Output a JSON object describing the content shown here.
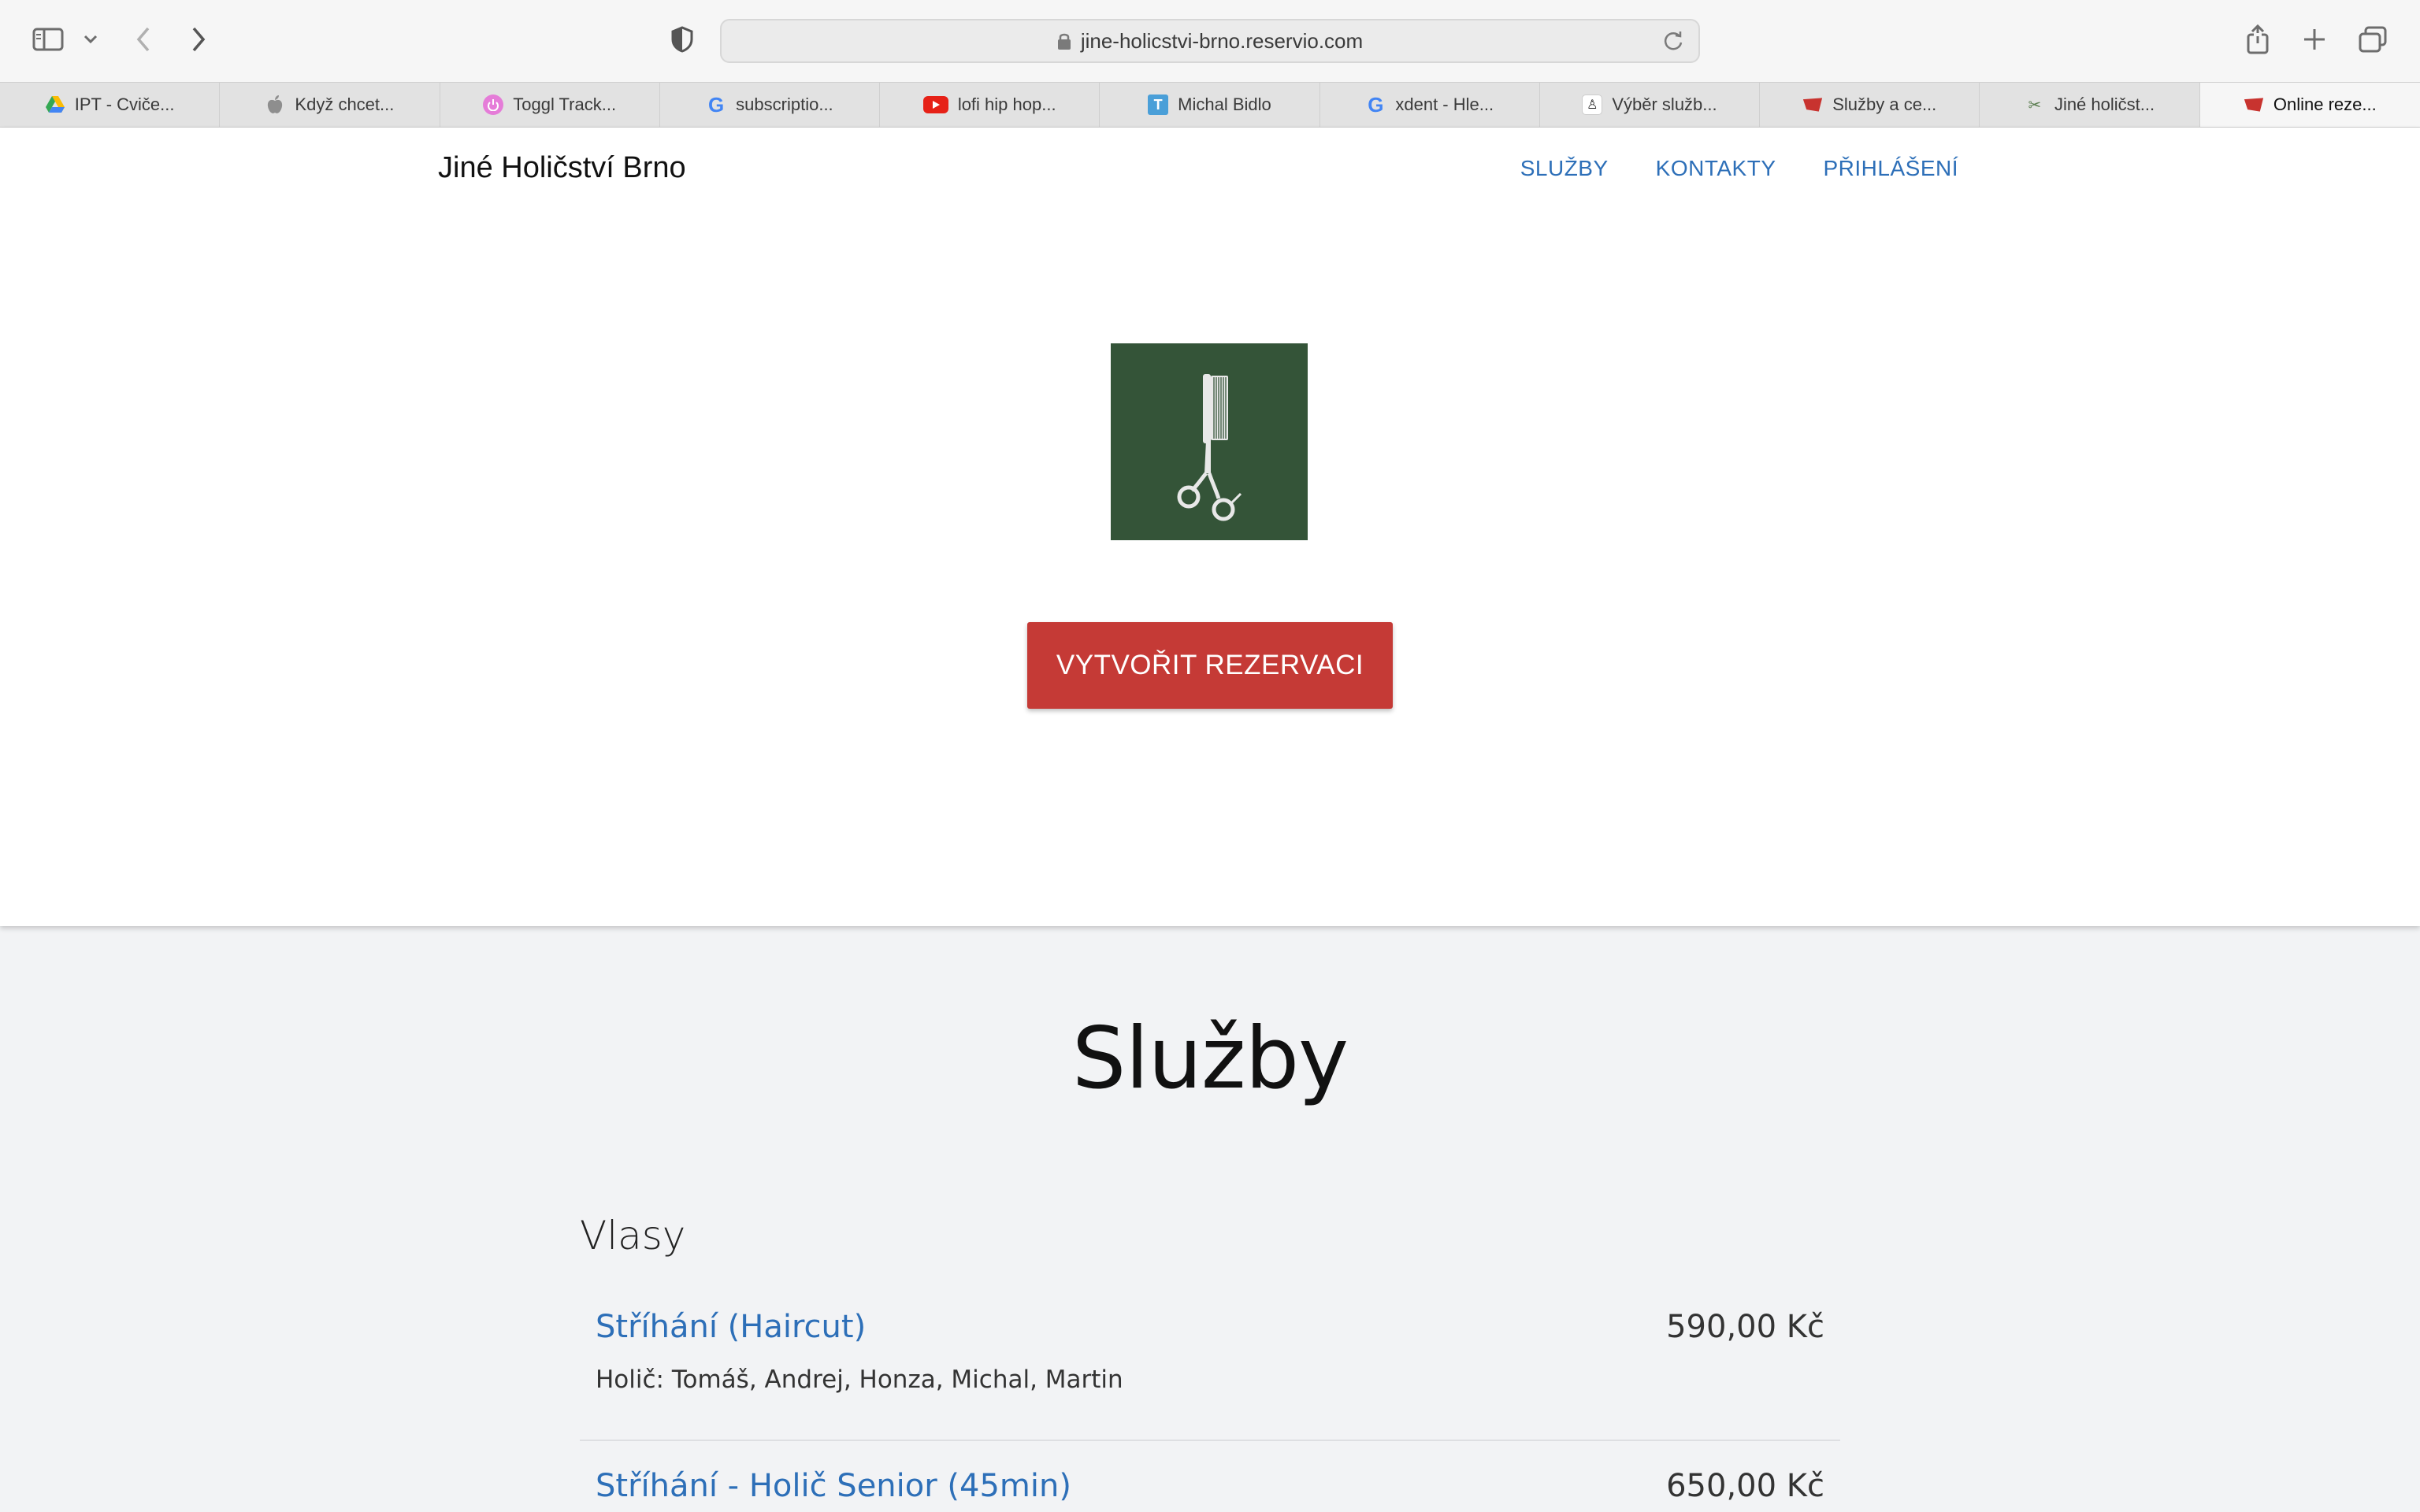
{
  "browser": {
    "url": "jine-holicstvi-brno.reservio.com",
    "tabs": [
      {
        "label": "IPT - Cviče...",
        "icon": "google-drive-icon"
      },
      {
        "label": "Když chcet...",
        "icon": "apple-icon"
      },
      {
        "label": "Toggl Track...",
        "icon": "toggl-icon"
      },
      {
        "label": "subscriptio...",
        "icon": "google-icon"
      },
      {
        "label": "lofi hip hop...",
        "icon": "youtube-icon"
      },
      {
        "label": "Michal Bidlo",
        "icon": "t-icon"
      },
      {
        "label": "xdent - Hle...",
        "icon": "google-icon"
      },
      {
        "label": "Výběr služb...",
        "icon": "barber-icon"
      },
      {
        "label": "Služby a ce...",
        "icon": "reservio-icon"
      },
      {
        "label": "Jiné holičst...",
        "icon": "scissors-icon"
      },
      {
        "label": "Online reze...",
        "icon": "reservio-icon"
      }
    ]
  },
  "header": {
    "brand": "Jiné Holičství Brno",
    "nav": [
      "SLUŽBY",
      "KONTAKTY",
      "PŘIHLÁŠENÍ"
    ]
  },
  "hero": {
    "cta": "VYTVOŘIT REZERVACI"
  },
  "services": {
    "title": "Služby",
    "category": "Vlasy",
    "items": [
      {
        "name": "Stříhání (Haircut)",
        "price": "590,00 Kč",
        "barbers": "Holič: Tomáš, Andrej, Honza, Michal, Martin"
      },
      {
        "name": "Stříhání - Holič Senior (45min)",
        "price": "650,00 Kč"
      }
    ]
  },
  "colors": {
    "accent": "#2d6fb8",
    "cta": "#c53a36",
    "logo_bg": "#345438"
  }
}
